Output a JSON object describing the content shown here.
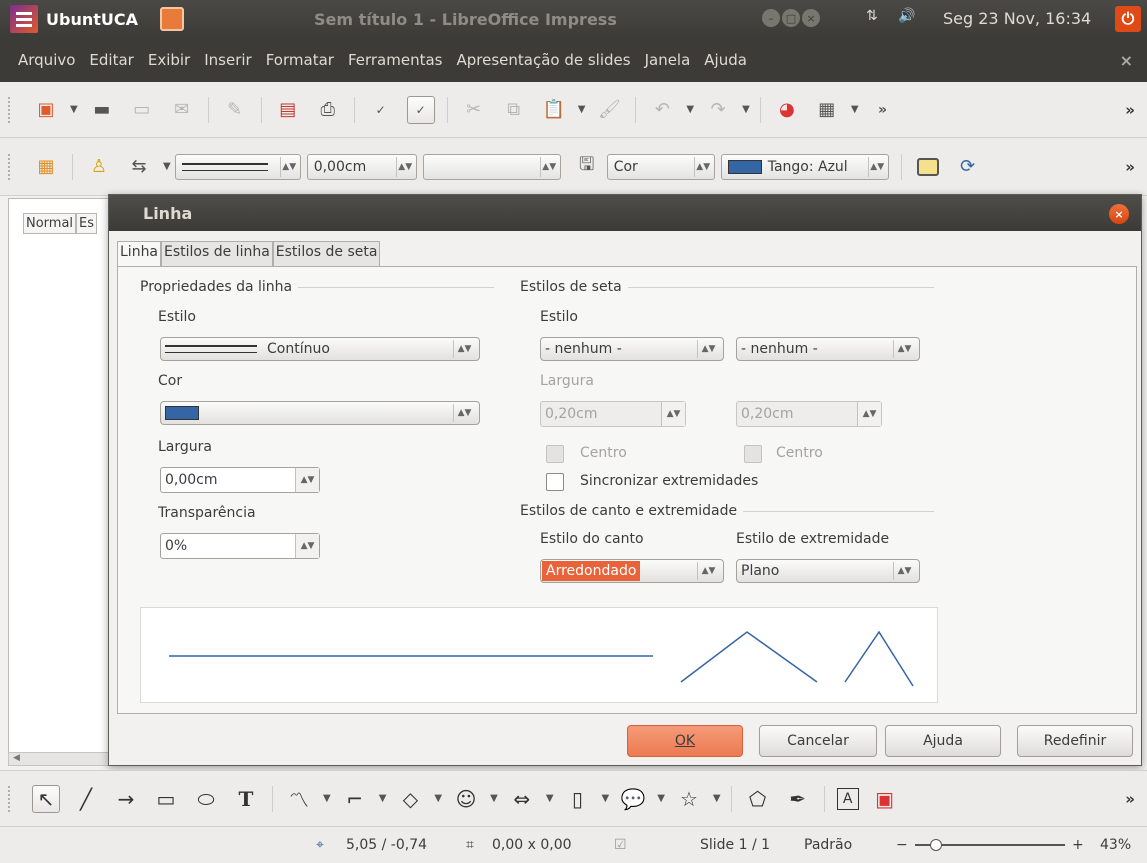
{
  "topbar": {
    "app_name": "UbuntUCA",
    "window_title": "Sem título 1 - LibreOffice Impress",
    "clock": "Seg 23 Nov, 16:34"
  },
  "menubar": {
    "items": [
      "Arquivo",
      "Editar",
      "Exibir",
      "Inserir",
      "Formatar",
      "Ferramentas",
      "Apresentação de slides",
      "Janela",
      "Ajuda"
    ]
  },
  "line_toolbar": {
    "width_value": "0,00cm",
    "color_area_label": "Cor",
    "color_value": "Tango: Azul"
  },
  "left_pane": {
    "tab_normal": "Normal",
    "tab_next": "Es"
  },
  "dialog": {
    "title": "Linha",
    "tabs": [
      "Linha",
      "Estilos de linha",
      "Estilos de seta"
    ],
    "line_properties": {
      "title": "Propriedades da linha",
      "style_label": "Estilo",
      "style_value": "Contínuo",
      "color_label": "Cor",
      "color_hex": "#3465a4",
      "width_label": "Largura",
      "width_value": "0,00cm",
      "transparency_label": "Transparência",
      "transparency_value": "0%"
    },
    "arrow_styles": {
      "title": "Estilos de seta",
      "style_label": "Estilo",
      "start_value": "- nenhum -",
      "end_value": "- nenhum -",
      "width_label": "Largura",
      "start_width": "0,20cm",
      "end_width": "0,20cm",
      "center_label": "Centro",
      "sync_label": "Sincronizar extremidades"
    },
    "corner_styles": {
      "title": "Estilos de canto e extremidade",
      "corner_label": "Estilo do canto",
      "corner_value": "Arredondado",
      "cap_label": "Estilo de extremidade",
      "cap_value": "Plano"
    },
    "buttons": {
      "ok": "OK",
      "cancel": "Cancelar",
      "help": "Ajuda",
      "reset": "Redefinir"
    }
  },
  "statusbar": {
    "position": "5,05 / -0,74",
    "size": "0,00 x 0,00",
    "slide": "Slide 1 / 1",
    "layout": "Padrão",
    "zoom": "43%"
  },
  "colors": {
    "accent": "#e8633a",
    "line_blue": "#3465a4"
  }
}
